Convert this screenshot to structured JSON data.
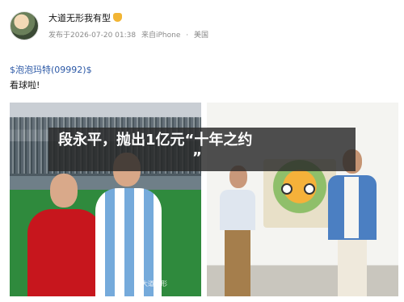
{
  "post": {
    "username": "大道无形我有型",
    "vip_icon": "vip-badge-icon",
    "meta": {
      "published": "发布于2026-07-20 01:38",
      "source": "来自iPhone",
      "separator": "·",
      "location": "美国"
    },
    "stock_tag": "$泡泡玛特(09992)$",
    "text": "看球啦!",
    "watermark": "大道无形"
  },
  "headline": {
    "line1": "段永平，抛出1亿元“十年之约",
    "line2": "”"
  }
}
